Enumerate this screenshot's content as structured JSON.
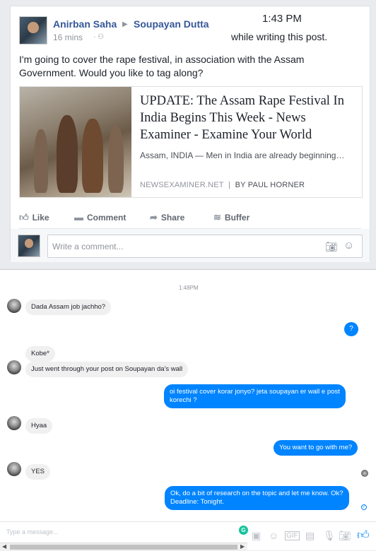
{
  "post": {
    "author": "Anirban Saha",
    "target": "Soupayan Dutta",
    "time": "16 mins",
    "note_time": "1:43 PM",
    "note_text": "while writing this post.",
    "text": "I'm going to cover the rape festival, in association with the Assam Government. Would you like to tag along?",
    "link": {
      "title": "UPDATE: The Assam Rape Festival In India Begins This Week - News Examiner - Examine Your World",
      "description": "Assam, INDIA — Men in India are already beginning…",
      "source": "NEWSEXAMINER.NET",
      "separator": "|",
      "byline": "BY PAUL HORNER"
    },
    "actions": {
      "like": "Like",
      "comment": "Comment",
      "share": "Share",
      "buffer": "Buffer"
    },
    "comment_placeholder": "Write a comment..."
  },
  "chat": {
    "timestamp": "1:48PM",
    "messages": {
      "m1": "Dada Assam job jachho?",
      "m2": "?",
      "m3": "Kobe*",
      "m4": "Just went through your post on Soupayan da's wall",
      "m5_line1": "oi festival cover korar jonyo? jeta soupayan er wall e post",
      "m5_line2": "korechi ?",
      "m6": "Hyaa",
      "m7": "You want to go with me?",
      "m8": "YES",
      "m9_line1": "Ok, do a bit of research on the topic and let me know. Ok?",
      "m9_line2": "Deadline: Tonight."
    },
    "compose_placeholder": "Type a message...",
    "icons": [
      "grammarly-icon",
      "sticker-icon",
      "emoji-icon",
      "gif-icon",
      "file-icon",
      "mic-icon",
      "camera-icon",
      "like-icon"
    ]
  }
}
